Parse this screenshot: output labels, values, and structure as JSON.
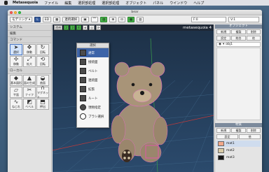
{
  "menubar": {
    "app": "Metasequoia",
    "items": [
      "ファイル",
      "編集",
      "選択部処理",
      "選択部処理",
      "オブジェクト",
      "パネル",
      "ウインドウ",
      "ヘルプ"
    ]
  },
  "window": {
    "title": "bear"
  },
  "toolbar": {
    "mode": "モデリング",
    "layer_l": "L",
    "edit": "ED",
    "link_tip": "連続選択",
    "field1": "F:0",
    "field2": "V:1"
  },
  "left_panel": {
    "system": "システム",
    "edit": "編集",
    "command": "コマンド",
    "local": "ローカル",
    "tools": [
      {
        "label": "選択",
        "icon": "arrow"
      },
      {
        "label": "移動",
        "icon": "move"
      },
      {
        "label": "回転",
        "icon": "rotate"
      },
      {
        "label": "移動",
        "icon": "move2"
      },
      {
        "label": "拡大",
        "icon": "scale"
      },
      {
        "label": "回転",
        "icon": "rotate2"
      },
      {
        "label": "基本図形",
        "icon": "shape"
      },
      {
        "label": "面の生成",
        "icon": "face"
      },
      {
        "label": "曲面",
        "icon": "surface"
      },
      {
        "label": "平面",
        "icon": "plane"
      },
      {
        "label": "ナイフ",
        "icon": "knife"
      },
      {
        "label": "マグネット",
        "icon": "magnet"
      },
      {
        "label": "ねじれ",
        "icon": "twist"
      },
      {
        "label": "ベベル",
        "icon": "bevel"
      },
      {
        "label": "押出",
        "icon": "extrude"
      }
    ]
  },
  "viewport": {
    "logo": "metasequoia 4",
    "buttons": [
      "透視",
      "2",
      "3",
      "4",
      "⊕",
      "◎",
      "⟳"
    ]
  },
  "select_popup": {
    "title": "選択",
    "items": [
      "通常",
      "接続面",
      "ベルト",
      "連続面",
      "拡張",
      "ルート",
      "現物指定",
      "ブラシ選択"
    ],
    "selected": 0
  },
  "right_panel": {
    "object_title": "オブジェクト",
    "object_buttons": [
      "新規",
      "複製",
      "削除",
      "設定",
      "統合",
      "他"
    ],
    "objects": [
      "obj1"
    ],
    "material_title": "材質",
    "material_buttons": [
      "新規",
      "複製",
      "削除",
      "設定",
      "他"
    ],
    "materials": [
      {
        "name": "mat1",
        "color": "#f2a88a"
      },
      {
        "name": "mat2",
        "color": "#d9cba6"
      },
      {
        "name": "mat3",
        "color": "#151515"
      }
    ]
  }
}
